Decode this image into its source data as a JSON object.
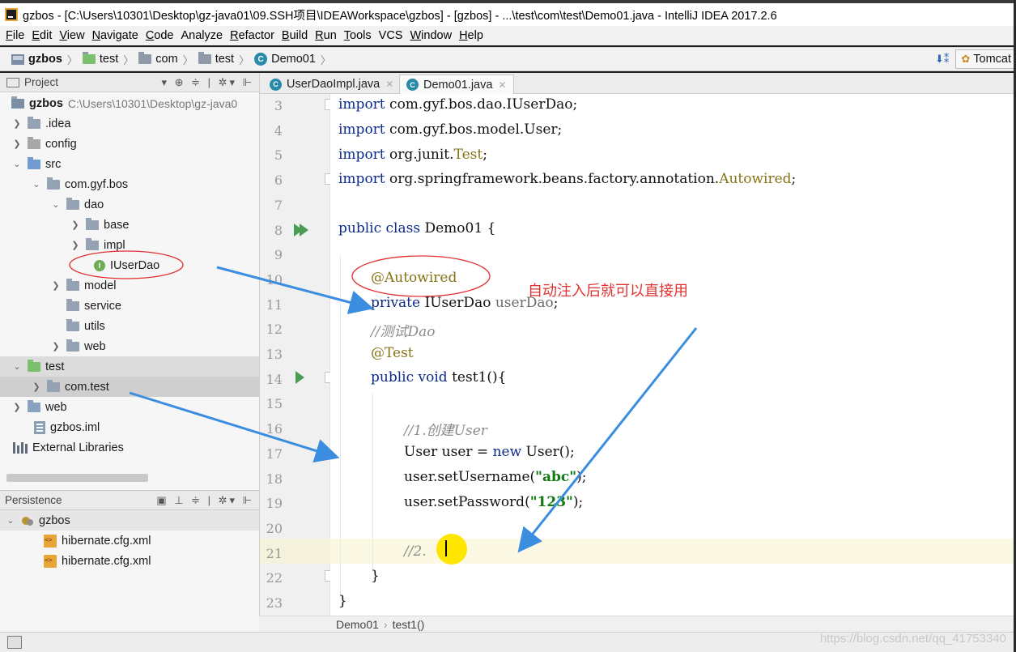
{
  "window": {
    "title": "gzbos - [C:\\Users\\10301\\Desktop\\gz-java01\\09.SSH项目\\IDEAWorkspace\\gzbos] - [gzbos] - ...\\test\\com\\test\\Demo01.java - IntelliJ IDEA 2017.2.6"
  },
  "menu": [
    {
      "label": "File",
      "mnemonic": "F",
      "rest": "ile"
    },
    {
      "label": "Edit",
      "mnemonic": "E",
      "rest": "dit"
    },
    {
      "label": "View",
      "mnemonic": "V",
      "rest": "iew"
    },
    {
      "label": "Navigate",
      "mnemonic": "N",
      "rest": "avigate"
    },
    {
      "label": "Code",
      "mnemonic": "C",
      "rest": "ode"
    },
    {
      "label": "Analyze",
      "mnemonic": "",
      "rest": "Analyze"
    },
    {
      "label": "Refactor",
      "mnemonic": "R",
      "rest": "efactor"
    },
    {
      "label": "Build",
      "mnemonic": "B",
      "rest": "uild"
    },
    {
      "label": "Run",
      "mnemonic": "R",
      "rest": "un"
    },
    {
      "label": "Tools",
      "mnemonic": "T",
      "rest": "ools"
    },
    {
      "label": "VCS",
      "mnemonic": "",
      "rest": "VCS"
    },
    {
      "label": "Window",
      "mnemonic": "W",
      "rest": "indow"
    },
    {
      "label": "Help",
      "mnemonic": "H",
      "rest": "elp"
    }
  ],
  "navbar": {
    "crumbs": [
      "gzbos",
      "test",
      "com",
      "test",
      "Demo01"
    ],
    "run_config": "Tomcat"
  },
  "project_panel": {
    "title": "Project",
    "tree": [
      {
        "label": "gzbos",
        "path": "C:\\Users\\10301\\Desktop\\gz-java0"
      },
      {
        "label": ".idea"
      },
      {
        "label": "config"
      },
      {
        "label": "src"
      },
      {
        "label": "com.gyf.bos"
      },
      {
        "label": "dao"
      },
      {
        "label": "base"
      },
      {
        "label": "impl"
      },
      {
        "label": "IUserDao",
        "icon_letter": "I"
      },
      {
        "label": "model"
      },
      {
        "label": "service"
      },
      {
        "label": "utils"
      },
      {
        "label": "web"
      },
      {
        "label": "test"
      },
      {
        "label": "com.test"
      },
      {
        "label": "web"
      },
      {
        "label": "gzbos.iml"
      },
      {
        "label": "External Libraries"
      }
    ]
  },
  "persistence_panel": {
    "title": "Persistence",
    "tree": [
      {
        "label": "gzbos"
      },
      {
        "label": "hibernate.cfg.xml"
      },
      {
        "label": "hibernate.cfg.xml"
      }
    ]
  },
  "editor": {
    "tabs": [
      {
        "label": "UserDaoImpl.java",
        "icon_letter": "C",
        "active": false
      },
      {
        "label": "Demo01.java",
        "icon_letter": "C",
        "active": true
      }
    ],
    "line_numbers": [
      "3",
      "4",
      "5",
      "6",
      "7",
      "8",
      "9",
      "10",
      "11",
      "12",
      "13",
      "14",
      "15",
      "16",
      "17",
      "18",
      "19",
      "20",
      "21",
      "22",
      "23"
    ],
    "code": {
      "l3_kw": "import",
      "l3_rest": " com.gyf.bos.dao.IUserDao;",
      "l4_kw": "import",
      "l4_rest": " com.gyf.bos.model.User;",
      "l5_kw": "import",
      "l5_rest": " org.junit.",
      "l5_ann": "Test",
      "l5_end": ";",
      "l6_kw": "import",
      "l6_rest": " org.springframework.beans.factory.annotation.",
      "l6_ann": "Autowired",
      "l6_end": ";",
      "l8_kw": "public class",
      "l8_rest": " Demo01 {",
      "l10_ann": "@Autowired",
      "l11_kw": "private",
      "l11_rest": " IUserDao ",
      "l11_dim": "userDao",
      "l11_end": ";",
      "l12_cmt": "//测试Dao",
      "l13_ann": "@Test",
      "l14_kw": "public void",
      "l14_rest": " test1(){",
      "l16_cmt": "//1.创建User",
      "l17_a": "User user = ",
      "l17_kw": "new",
      "l17_b": " User();",
      "l18_a": "user.setUsername(",
      "l18_str": "\"abc\"",
      "l18_b": ");",
      "l19_a": "user.setPassword(",
      "l19_str": "\"123\"",
      "l19_b": ");",
      "l21_cmt": "//2.",
      "l22": "}",
      "l23": "}"
    },
    "breadcrumb": [
      "Demo01",
      "test1()"
    ]
  },
  "annotation_text": "自动注入后就可以直接用",
  "watermark": "https://blog.csdn.net/qq_41753340",
  "colors": {
    "keyword": "#0c2a8a",
    "annotation": "#857314",
    "comment": "#8b8b8b",
    "string": "#0f7a12",
    "arrow": "#3b8de0",
    "highlight_circle": "#e03131",
    "cursor_highlight": "#ffe600"
  }
}
